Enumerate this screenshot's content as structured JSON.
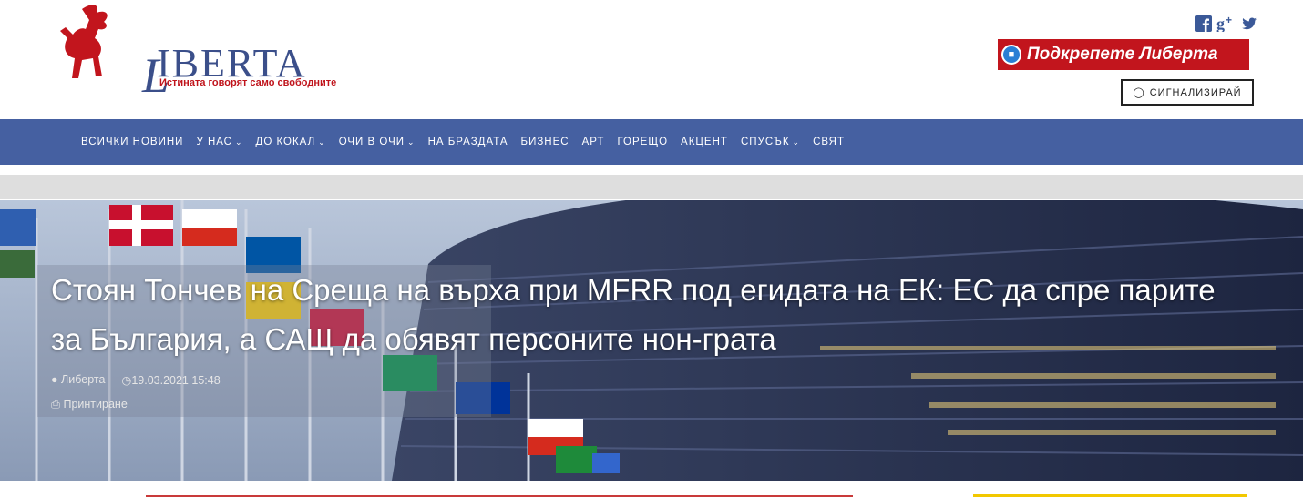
{
  "logo": {
    "text": "IBERTA",
    "initial": "L",
    "tagline": "Истината говорят само свободните"
  },
  "social": {
    "icons": [
      "facebook-icon",
      "google-plus-icon",
      "twitter-icon"
    ],
    "color": "#3b5998"
  },
  "support": {
    "label": "Подкрепете Либерта",
    "bg": "#c2151d"
  },
  "signal": {
    "label": "СИГНАЛИЗИРАЙ"
  },
  "nav": {
    "bg": "#4560a1",
    "items": [
      {
        "label": "ВСИЧКИ НОВИНИ",
        "dropdown": false
      },
      {
        "label": "У НАС",
        "dropdown": true
      },
      {
        "label": "ДО КОКАЛ",
        "dropdown": true
      },
      {
        "label": "ОЧИ В ОЧИ",
        "dropdown": true
      },
      {
        "label": "НА БРАЗДАТА",
        "dropdown": false
      },
      {
        "label": "БИЗНЕС",
        "dropdown": false
      },
      {
        "label": "АРТ",
        "dropdown": false
      },
      {
        "label": "ГОРЕЩО",
        "dropdown": false
      },
      {
        "label": "АКЦЕНТ",
        "dropdown": false
      },
      {
        "label": "СПУСЪК",
        "dropdown": true
      },
      {
        "label": "СВЯТ",
        "dropdown": false
      }
    ]
  },
  "article": {
    "title": "Стоян Тончев на Среща на върха при MFRR под егидата на ЕК: ЕС да спре парите за България, а САЩ да обявят персоните нон-грата",
    "author": "Либерта",
    "date": "19.03.2021 15:48",
    "print_label": "Принтиране"
  }
}
